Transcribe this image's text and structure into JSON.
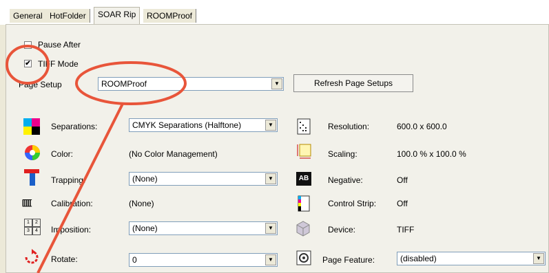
{
  "tabs": [
    {
      "label": "General"
    },
    {
      "label": "HotFolder"
    },
    {
      "label": "SOAR Rip"
    },
    {
      "label": "ROOMProof"
    }
  ],
  "options": {
    "pause_after": {
      "label": "Pause After",
      "checked": false
    },
    "tiff_mode": {
      "label": "TIFF Mode",
      "checked": true
    }
  },
  "page_setup": {
    "label": "Page Setup",
    "value": "ROOMProof",
    "refresh_label": "Refresh Page Setups"
  },
  "left": {
    "separations": {
      "label": "Separations:",
      "value": "CMYK Separations (Halftone)"
    },
    "color": {
      "label": "Color:",
      "value": "(No Color Management)"
    },
    "trapping": {
      "label": "Trapping:",
      "value": "(None)"
    },
    "calibration": {
      "label": "Calibration:",
      "value": "(None)"
    },
    "imposition": {
      "label": "Imposition:",
      "value": "(None)"
    },
    "rotate": {
      "label": "Rotate:",
      "value": "0"
    }
  },
  "right": {
    "resolution": {
      "label": "Resolution:",
      "value": "600.0 x 600.0"
    },
    "scaling": {
      "label": "Scaling:",
      "value": "100.0 % x 100.0 %"
    },
    "negative": {
      "label": "Negative:",
      "value": "Off"
    },
    "control_strip": {
      "label": "Control Strip:",
      "value": "Off"
    },
    "device": {
      "label": "Device:",
      "value": "TIFF"
    },
    "page_feature": {
      "label": "Page Feature:",
      "value": "(disabled)"
    }
  },
  "icons": {
    "negative_glyph": "AB",
    "calibration_glyph": "[[[[[",
    "imposition_cells": [
      "1",
      "2",
      "3",
      "4"
    ]
  },
  "annotation_color": "#e8553a"
}
